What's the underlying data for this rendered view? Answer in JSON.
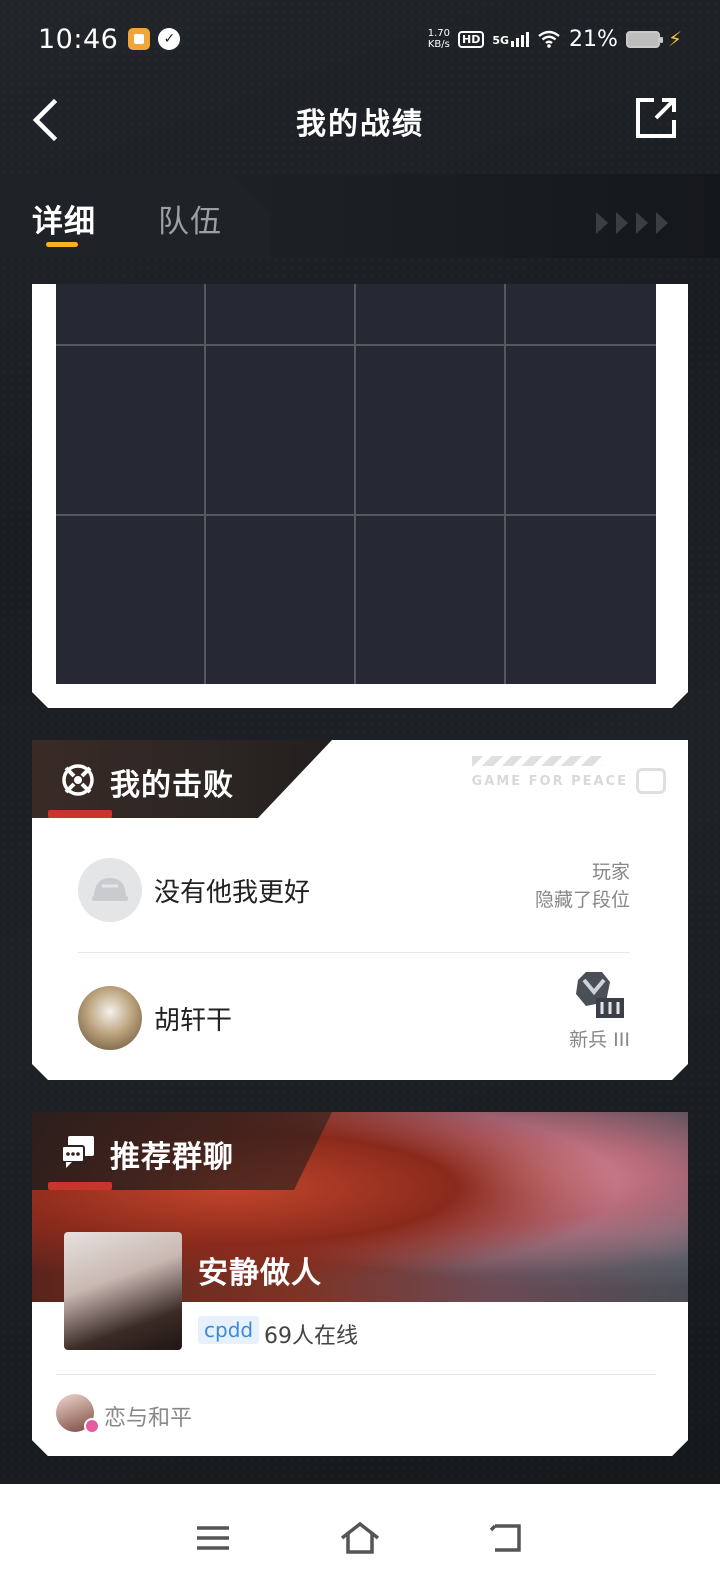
{
  "status_bar": {
    "time": "10:46",
    "net_speed_value": "1.70",
    "net_speed_unit": "KB/s",
    "hd_label": "HD",
    "network_label": "5G",
    "battery_percent": "21%"
  },
  "header": {
    "title": "我的战绩"
  },
  "tabs": [
    {
      "label": "详细",
      "active": true
    },
    {
      "label": "队伍",
      "active": false
    }
  ],
  "defeats": {
    "title": "我的击败",
    "brand_text": "GAME FOR PEACE",
    "players": [
      {
        "name": "没有他我更好",
        "rank_line1": "玩家",
        "rank_line2": "隐藏了段位"
      },
      {
        "name": "胡轩干",
        "rank_line1": "新兵 III"
      }
    ]
  },
  "group_chat": {
    "title": "推荐群聊",
    "group_name": "安静做人",
    "tag": "cpdd",
    "online": "69人在线",
    "member_name": "恋与和平"
  },
  "colors": {
    "accent_yellow": "#f4b41a",
    "accent_red": "#c7352c",
    "tag_blue": "#3b8ad6"
  }
}
